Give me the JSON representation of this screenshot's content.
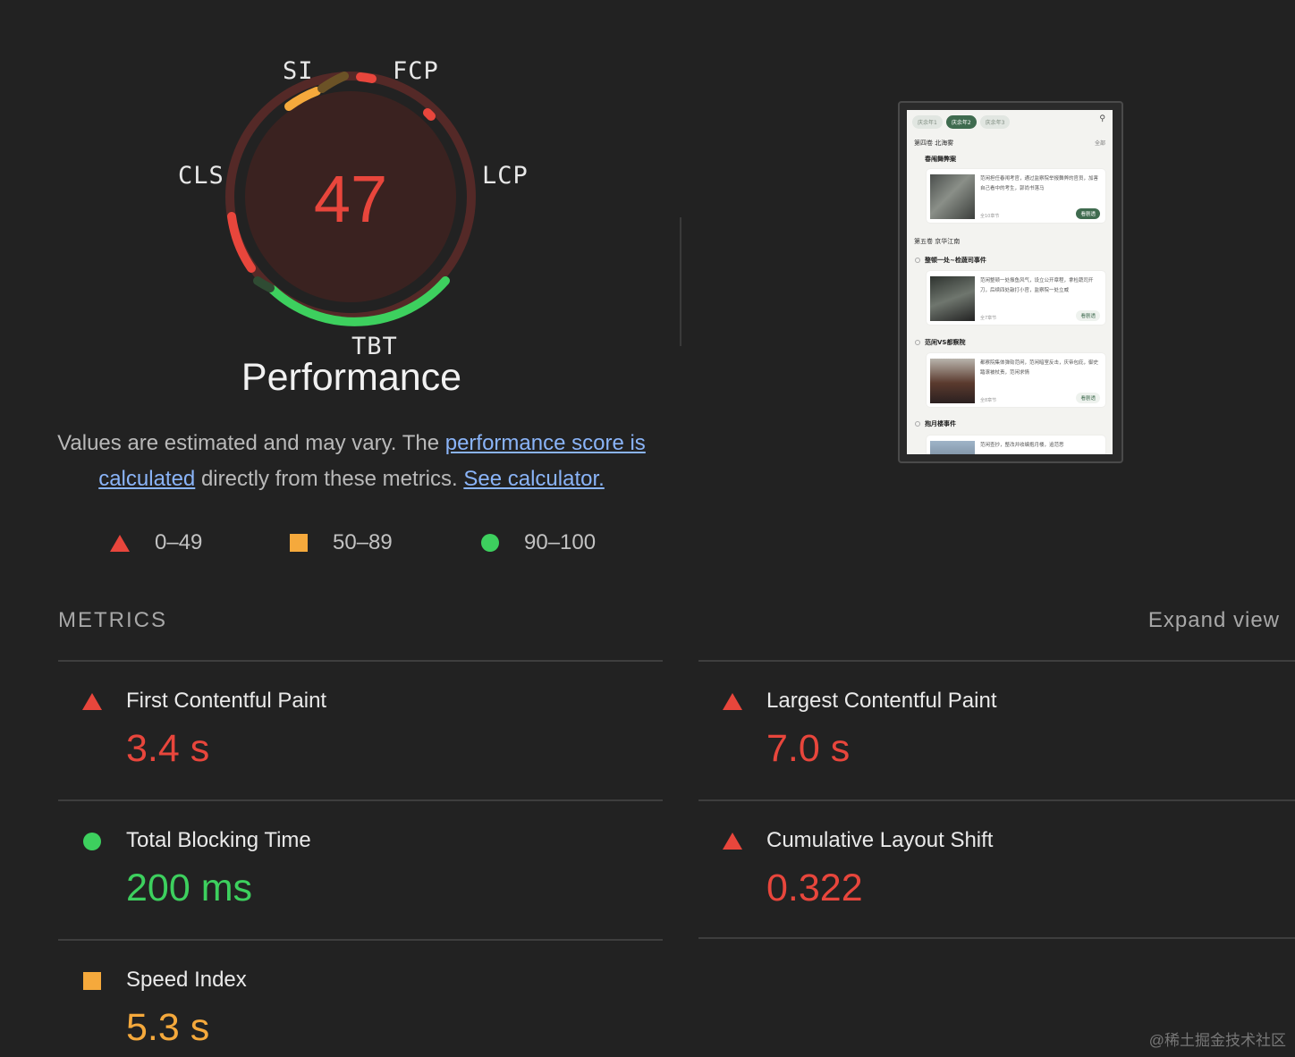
{
  "gauge": {
    "score": "47",
    "labels": {
      "si": "SI",
      "fcp": "FCP",
      "lcp": "LCP",
      "tbt": "TBT",
      "cls": "CLS"
    },
    "colors": {
      "fail": "#e8463c",
      "average": "#f5a93c",
      "pass": "#3dd05e",
      "fail_bg": "#3a2220"
    }
  },
  "performance": {
    "title": "Performance",
    "desc_part1": "Values are estimated and may vary. The ",
    "desc_link1": "performance score is calculated",
    "desc_part2": " directly from these metrics. ",
    "desc_link2": "See calculator."
  },
  "legend": {
    "fail": "0–49",
    "average": "50–89",
    "pass": "90–100"
  },
  "screenshot": {
    "tabs": [
      "庆余年1",
      "庆余年2",
      "庆余年3"
    ],
    "vol4": "第四卷 北海雾",
    "vol4_right": "全部",
    "item1_title": "春闱舞弊案",
    "item1_text": "范闲担任春闱考官，通过监察院举报舞弊的官员，加害自己看中的考生，郭尚书落马",
    "item1_meta": "全10章节",
    "item1_btn": "看剧透",
    "vol5": "第五卷 京华江南",
    "item2_title": "整顿一处~检蔬司事件",
    "item2_text": "范闲整顿一处振鱼风气，设立公开章程，拿检蔬司开刀，后续四处敲打小官，监察院一处立威",
    "item2_meta": "全7章节",
    "item2_btn": "看剧透",
    "item3_title": "范闲VS都察院",
    "item3_text": "都察院集体弹劾范闲，范闲暗室反击，庆帝包庇，御史踏滚被杖责，范闲求情",
    "item3_meta": "全8章节",
    "item3_btn": "看剧透",
    "item4_title": "抱月楼事件",
    "item4_text": "范闲查抄，整改并收编抱月楼，追范思"
  },
  "metrics": {
    "title": "METRICS",
    "expand_label": "Expand view",
    "fcp": {
      "name": "First Contentful Paint",
      "value": "3.4 s"
    },
    "lcp": {
      "name": "Largest Contentful Paint",
      "value": "7.0 s"
    },
    "tbt": {
      "name": "Total Blocking Time",
      "value": "200 ms"
    },
    "cls": {
      "name": "Cumulative Layout Shift",
      "value": "0.322"
    },
    "si": {
      "name": "Speed Index",
      "value": "5.3 s"
    }
  },
  "watermark": "@稀土掘金技术社区"
}
